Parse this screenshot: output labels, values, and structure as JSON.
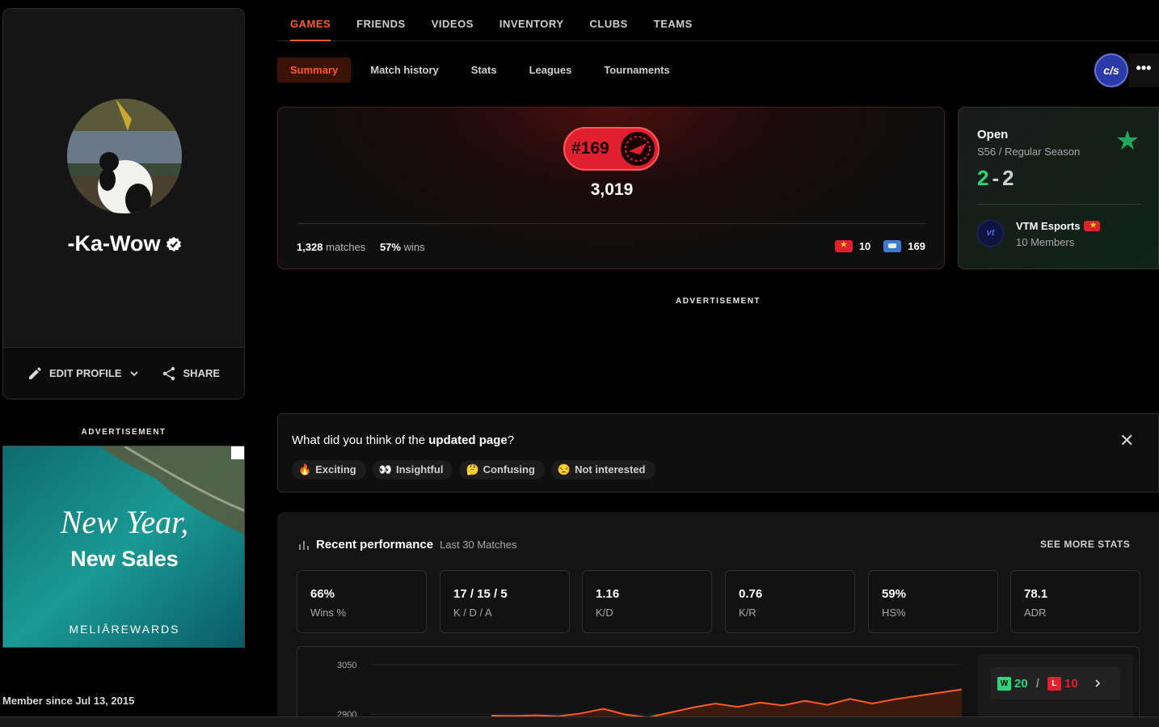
{
  "profile": {
    "name": "-Ka-Wow",
    "edit_label": "EDIT PROFILE",
    "share_label": "SHARE",
    "member_since": "Member since Jul 13, 2015"
  },
  "ads": {
    "label": "ADVERTISEMENT",
    "banner_line1": "New Year,",
    "banner_line2": "New Sales",
    "banner_brand": "MELIĀREWARDS"
  },
  "top_nav": [
    "GAMES",
    "FRIENDS",
    "VIDEOS",
    "INVENTORY",
    "CLUBS",
    "TEAMS"
  ],
  "sub_nav": [
    "Summary",
    "Match history",
    "Stats",
    "Leagues",
    "Tournaments"
  ],
  "game_logo": "c/s",
  "more_label": "•••",
  "rank": {
    "position": "#169",
    "elo": "3,019",
    "matches_value": "1,328",
    "matches_label": "matches",
    "wins_value": "57%",
    "wins_label": "wins",
    "country_rank": "10",
    "region_rank": "169"
  },
  "league": {
    "title": "Open",
    "season": "S56 / Regular Season",
    "wins": "2",
    "separator": "-",
    "losses": "2",
    "team_name": "VTM Esports",
    "team_members": "10 Members",
    "team_logo": "vt"
  },
  "feedback": {
    "question_prefix": "What did you think of the ",
    "question_bold": "updated page",
    "question_suffix": "?",
    "options": [
      {
        "emoji": "🔥",
        "label": "Exciting"
      },
      {
        "emoji": "👀",
        "label": "Insightful"
      },
      {
        "emoji": "🤔",
        "label": "Confusing"
      },
      {
        "emoji": "😒",
        "label": "Not interested"
      }
    ],
    "close": "✕"
  },
  "performance": {
    "title": "Recent performance",
    "subtitle": "Last 30 Matches",
    "see_more": "SEE MORE STATS",
    "stats": [
      {
        "value": "66%",
        "label": "Wins %"
      },
      {
        "value": "17 / 15 / 5",
        "label": "K / D / A"
      },
      {
        "value": "1.16",
        "label": "K/D"
      },
      {
        "value": "0.76",
        "label": "K/R"
      },
      {
        "value": "59%",
        "label": "HS%"
      },
      {
        "value": "78.1",
        "label": "ADR"
      }
    ],
    "chart_ticks": [
      "3050",
      "2900"
    ],
    "wins": "20",
    "losses": "10",
    "w_badge": "W",
    "l_badge": "L",
    "wl_separator": "/"
  },
  "colors": {
    "accent": "#ff5a1f",
    "win": "#2bd67b",
    "loss": "#e0202e"
  },
  "chart_data": {
    "type": "area",
    "title": "",
    "xlabel": "",
    "ylabel": "",
    "ylim": [
      2900,
      3050
    ],
    "yticks": [
      3050,
      2900
    ],
    "series": [
      {
        "values": [
          2895,
          2894,
          2896,
          2893,
          2902,
          2916,
          2898,
          2890,
          2905,
          2920,
          2932,
          2922,
          2935,
          2926,
          2940,
          2928,
          2946,
          2932,
          2945,
          2955,
          2965,
          2975
        ]
      }
    ]
  }
}
